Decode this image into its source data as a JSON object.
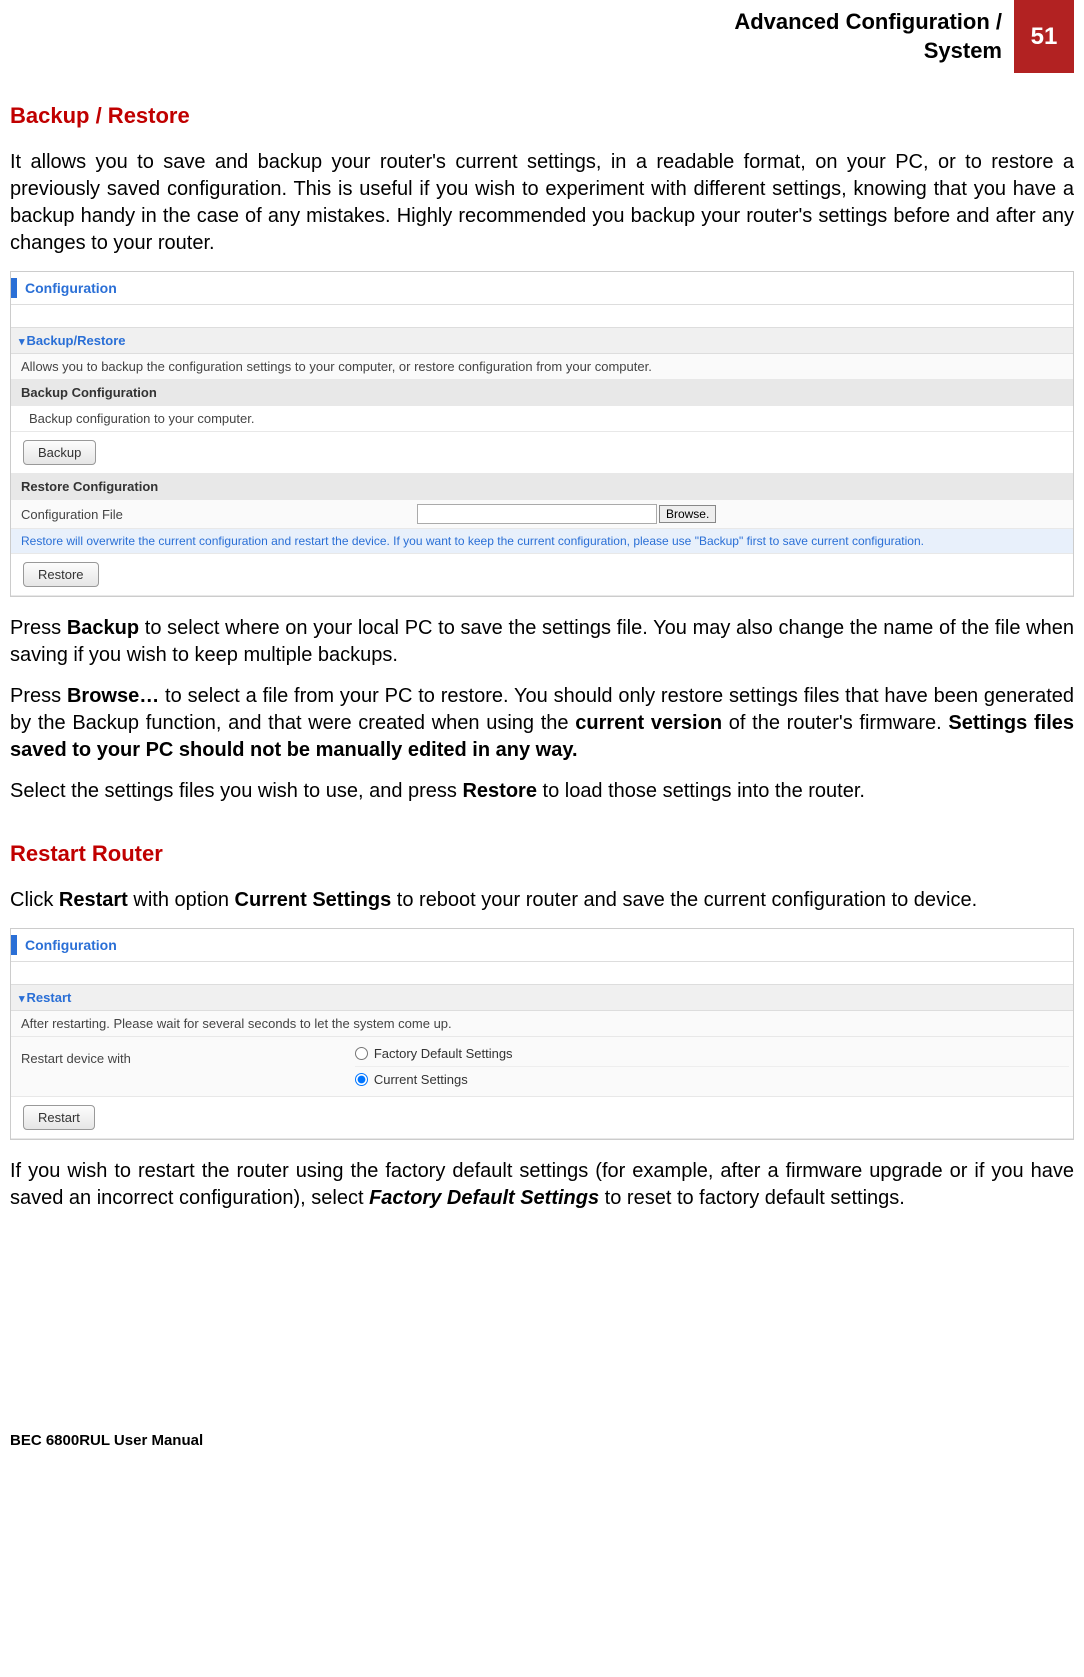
{
  "header": {
    "title_line1": "Advanced Configuration /",
    "title_line2": "System",
    "page_number": "51"
  },
  "section1": {
    "heading": "Backup / Restore",
    "intro": "It allows you to save and backup your router's current settings, in a readable format, on your PC, or to restore a previously saved configuration.  This is useful if you wish to experiment with different settings, knowing that you have a backup handy in the case of any mistakes.  Highly recommended you backup your router's settings before and after any changes to your router.",
    "para_backup_pre": "Press ",
    "para_backup_bold": "Backup",
    "para_backup_post": " to select where on your local PC to save the settings file. You may also change the name of the file when saving if you wish to keep multiple backups.",
    "para_browse_pre": "Press ",
    "para_browse_bold": "Browse…",
    "para_browse_mid": " to select a file from your PC to restore. You should only restore settings files that have been generated by the Backup function, and that were created when using the ",
    "para_browse_bold2": "current version",
    "para_browse_mid2": " of the router's firmware. ",
    "para_browse_bold3": "Settings files saved to your PC should not be manually edited in any way.",
    "para_restore_pre": "Select the settings files you wish to use, and press ",
    "para_restore_bold": "Restore",
    "para_restore_post": " to load those settings into the router."
  },
  "panel1": {
    "conf_label": "Configuration",
    "sect_head": "Backup/Restore",
    "desc_row": "Allows you to backup the configuration settings to your computer, or restore configuration from your computer.",
    "backup_head": "Backup Configuration",
    "backup_desc": "Backup configuration to your computer.",
    "backup_btn": "Backup",
    "restore_head": "Restore Configuration",
    "file_label": "Configuration File",
    "browse_btn": "Browse.",
    "restore_note": "Restore will overwrite the current configuration and restart the device. If you want to keep the current configuration, please use \"Backup\" first to save current configuration.",
    "restore_btn": "Restore"
  },
  "section2": {
    "heading": "Restart Router",
    "intro_pre": "Click ",
    "intro_b1": "Restart",
    "intro_mid": " with option ",
    "intro_b2": "Current Settings",
    "intro_post": " to reboot your router and save the current configuration to device.",
    "outro_pre": "If you wish to restart the router using the factory default settings (for example, after a firmware upgrade or if you have saved an incorrect configuration), select ",
    "outro_bold": "Factory Default Settings",
    "outro_post": " to reset to factory default settings."
  },
  "panel2": {
    "conf_label": "Configuration",
    "sect_head": "Restart",
    "desc_row": "After restarting. Please wait for several seconds to let the system come up.",
    "radio_label": "Restart device with",
    "opt1": "Factory Default Settings",
    "opt2": "Current Settings",
    "restart_btn": "Restart"
  },
  "footer": {
    "text": "BEC 6800RUL User Manual"
  }
}
